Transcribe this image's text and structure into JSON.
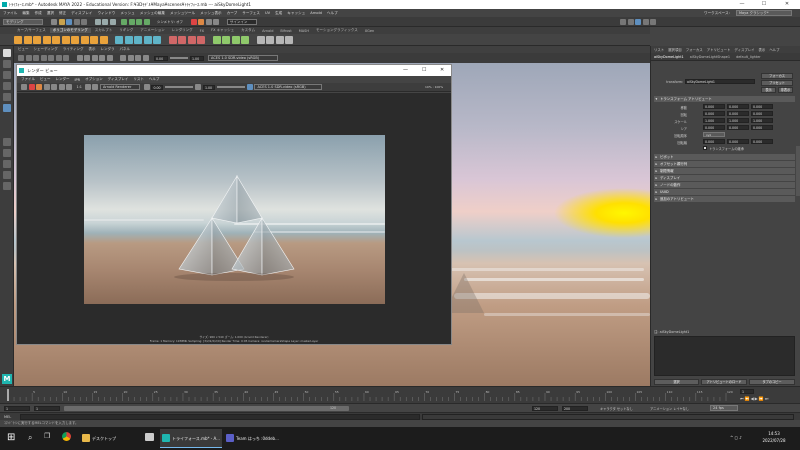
{
  "window": {
    "title": "ﾄﾗｲﾌｫｰｽ.mb* - Autodesk MAYA 2022 - Educational Version: F:¥3Dﾓﾃﾞﾙ¥Maya¥scenes¥ﾄﾗｲﾌｫｰｽ.mb  ---  aiSkyDomeLight1",
    "minimize": "—",
    "maximize": "☐",
    "close": "✕"
  },
  "menubar": {
    "items": [
      "ファイル",
      "編集",
      "作成",
      "選択",
      "修正",
      "ディスプレイ",
      "ウィンドウ",
      "メッシュ",
      "メッシュの編集",
      "メッシュツール",
      "メッシュ表示",
      "カーブ",
      "サーフェス",
      "UV",
      "生成",
      "キャッシュ",
      "Arnold",
      "ヘルプ"
    ],
    "workspace_label": "ワークスペース:",
    "workspace_value": "Maya クラシック*"
  },
  "statusline": {
    "mode_select": "モデリング",
    "symmetry": "シンメトリ: オフ",
    "signin": "サインイン"
  },
  "shelf_tabs": [
    "カーブ/サーフェス",
    "ポリゴンのモデリング",
    "スカルプト",
    "リギング",
    "アニメーション",
    "レンダリング",
    "FX",
    "FX キャッシュ",
    "カスタム",
    "Arnold",
    "Bifrost",
    "MASH",
    "モーショングラフィックス",
    "XGen"
  ],
  "shelf_active": 1,
  "viewport_menu": [
    "ビュー",
    "シェーディング",
    "ライティング",
    "表示",
    "レンダラ",
    "パネル"
  ],
  "viewport_toolbar": {
    "exposure": "0.00",
    "gamma": "1.00",
    "colorspace": "ACES 1.0 SDR-video (sRGB)"
  },
  "render_view": {
    "title": "レンダー ビュー",
    "menu": [
      "ファイル",
      "ビュー",
      "レンダー",
      "IPR",
      "オプション",
      "ディスプレイ",
      "リスト",
      "ヘルプ"
    ],
    "renderer": "Arnold Renderer",
    "exposure": "0.00",
    "gamma": "1.00",
    "colorspace": "ACES 1.0 SDR-video (sRGB)",
    "zoom": "1:1",
    "zoom_pct": "10% : 100%",
    "status_line1": "サイズ: 960 x 540  ズーム: 1.000     (Arnold Renderer)",
    "status_line2": "Frame: 1    Memory: 1938Mb    Sampling: [3/2/2/2/2/0]    Render Time: 0:05    Camera: renderCameraShape    Layer: masterLayer"
  },
  "attribute_editor": {
    "top_tabs": [
      "リスト",
      "選択項目",
      "フォーカス",
      "アトリビュート",
      "ディスプレイ",
      "表示",
      "ヘルプ"
    ],
    "node_tabs": [
      "aiSkyDomeLight1",
      "aiSkyDomeLightShape1",
      "default_lighter"
    ],
    "transform_label": "transform:",
    "transform_value": "aiSkyDomeLight1",
    "focus_button": "フォーカス",
    "presets_button": "プリセット",
    "show_button": "表示",
    "hide_button": "非表示",
    "section_transform": "トランスフォーム アトリビュート",
    "rows": [
      {
        "label": "移動",
        "values": [
          "0.000",
          "0.000",
          "0.000"
        ]
      },
      {
        "label": "回転",
        "values": [
          "0.000",
          "0.000",
          "0.000"
        ]
      },
      {
        "label": "スケール",
        "values": [
          "1.000",
          "1.000",
          "1.000"
        ]
      },
      {
        "label": "シア",
        "values": [
          "0.000",
          "0.000",
          "0.000"
        ]
      }
    ],
    "rotation_order_label": "回転順序",
    "rotation_order_value": "xyz",
    "rotation_axis_label": "回転軸",
    "rotation_axis_values": [
      "0.000",
      "0.000",
      "0.000"
    ],
    "inherit_label": "トランスフォームの継承",
    "section_pivot": "ピボット",
    "section_limits": "制限情報",
    "section_display": "ディスプレイ",
    "section_node": "ノードの動作",
    "section_uuid": "UUID",
    "section_extra": "追加のアトリビュート",
    "section_offset": "オフセット親行列",
    "notes_label": "注: aiSkyDomeLight1",
    "select_button": "選択",
    "load_attrs_button": "アトリビュートのロード",
    "copy_tab_button": "タブのコピー"
  },
  "timeslider": {
    "current_frame": "1",
    "end_frame": "120",
    "range_start": "1",
    "range_inner_start": "1",
    "range_inner_end": "120",
    "range_end": "120",
    "anim_end": "200",
    "fps": "24 fps",
    "character_set": "キャラクタ セットなし",
    "anim_layer": "アニメーション レイヤなし",
    "ticks": [
      "5",
      "10",
      "15",
      "20",
      "25",
      "30",
      "35",
      "40",
      "45",
      "50",
      "55",
      "60",
      "65",
      "70",
      "75",
      "80",
      "85",
      "90",
      "95",
      "100",
      "105",
      "110",
      "115",
      "120"
    ]
  },
  "cmdline": {
    "label": "MEL"
  },
  "helpline": {
    "text": "ｺﾏﾝﾄﾞﾗｲﾝに実行するMELコマンドを入力します。"
  },
  "taskbar": {
    "search": "ここに入力して検索",
    "apps": [
      {
        "label": "デスクトップ",
        "icon": "folder-icon"
      },
      {
        "label": "トライフォース.mb* - A...",
        "icon": "maya-icon"
      },
      {
        "label": "Team はっち :0ddeb...",
        "icon": "teams-icon"
      }
    ],
    "time": "14:53",
    "date": "2022/07/28"
  },
  "colors": {
    "accent": "#5e8fbf",
    "maya_teal": "#1fb6b0",
    "sun": "#ffee00"
  }
}
